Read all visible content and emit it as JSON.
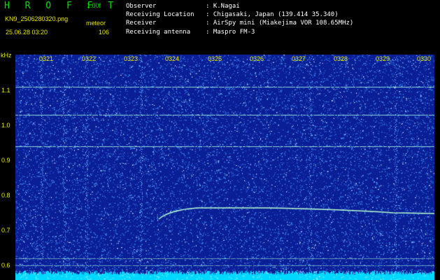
{
  "app": {
    "title": "H R O F F T",
    "version": "1.00f",
    "filename": "KN9_2506280320.png",
    "mode": "meteor",
    "datetime": "25.06.28 03:20",
    "count": "106"
  },
  "info": [
    {
      "key": "Observer",
      "value": ": K.Nagai"
    },
    {
      "key": "Receiving Location",
      "value": ": Chigasaki, Japan (139.414 35.340)"
    },
    {
      "key": "Receiver",
      "value": ": AirSpy mini (Miakejima VOR 108.65MHz)"
    },
    {
      "key": "Receiving antenna",
      "value": ": Maspro FM-3"
    }
  ],
  "spectrogram": {
    "unit": "kHz",
    "y_ticks": [
      "1.1",
      "1.0",
      "0.9",
      "0.8",
      "0.7",
      "0.6"
    ],
    "x_ticks": [
      "0321",
      "0322",
      "0323",
      "0324",
      "0325",
      "0326",
      "0327",
      "0328",
      "0329",
      "0330"
    ],
    "colors": {
      "background": "#0a1e96",
      "noise": "#4fa0ff",
      "signal": "#b8ffd0",
      "bottom_band": "#00d8ff",
      "label": "#e8e800",
      "title": "#00e000"
    }
  }
}
